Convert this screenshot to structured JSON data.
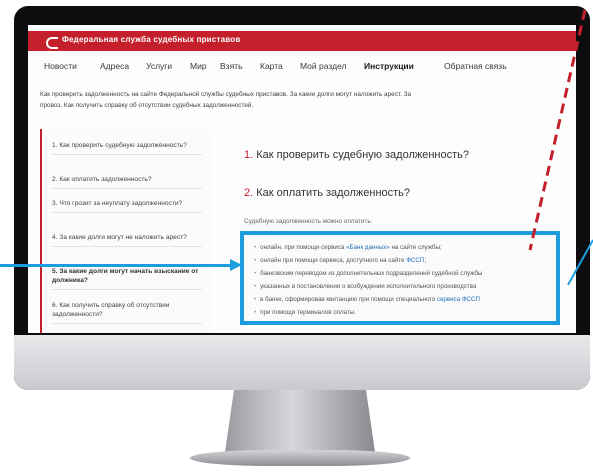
{
  "site": {
    "title": "Федеральная служба судебных приставов"
  },
  "nav": [
    {
      "label": "Новости"
    },
    {
      "label": "Адреса"
    },
    {
      "label": "Услуги"
    },
    {
      "label": "Мир"
    },
    {
      "label": "Взять"
    },
    {
      "label": "Карта"
    },
    {
      "label": "Мой раздел"
    },
    {
      "label": "Инструкции",
      "active": true
    },
    {
      "label": "Обратная связь"
    }
  ],
  "intro": {
    "line1": "Как проверить задолженность на сайте Федеральной службы судебных приставов. За какие долги могут наложить арест. За",
    "line2": "провоз. Как получить справку об отсутствии судебных задолженностей."
  },
  "sidebar": {
    "items": [
      {
        "label": "1. Как проверить судебную задолженность?"
      },
      {
        "label": "2. Как оплатить задолженность?"
      },
      {
        "label": "3. Что грозит за неуплату задолженности?"
      },
      {
        "label": "4. За какие долги могут не наложить арест?"
      },
      {
        "label": "5. За какие долги могут начать взыскание от должника?"
      },
      {
        "label": "6. Как получить справку об отсутствии задолженности?"
      }
    ]
  },
  "content": {
    "q1_num": "1.",
    "q1_text": " Как проверить судебную задолженность?",
    "q2_num": "2.",
    "q2_text": " Как оплатить задолженность?",
    "methods_label": "Судебную задолженность можно оплатить:",
    "methods": [
      {
        "pre": "онлайн, при помощи сервиса ",
        "link": "«Банк данных»",
        "post": " на сайте службы;"
      },
      {
        "pre": "онлайн при помощи сервиса, доступного на сайте ",
        "link": "ФССП",
        "post": ";"
      },
      {
        "pre": "банковским переводом из дополнительных подразделений судебной службы",
        "link": "",
        "post": ""
      },
      {
        "pre": "указанных в постановлении о возбуждении исполнительного производства",
        "link": "",
        "post": ""
      },
      {
        "pre": "в банке, сформировав квитанцию при помощи специального ",
        "link": "сервиса ФССП",
        "post": ""
      },
      {
        "pre": "при помощи терминалов оплаты.",
        "link": "",
        "post": ""
      }
    ]
  },
  "colors": {
    "brand_red": "#c3202b",
    "highlight_blue": "#1c9de0"
  }
}
